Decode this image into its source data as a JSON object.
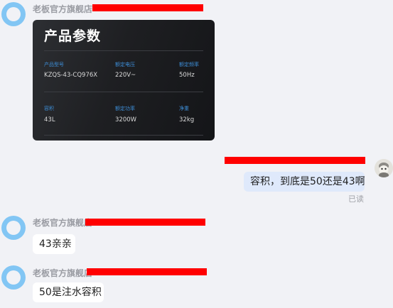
{
  "shop": {
    "name": "老板官方旗舰店"
  },
  "product_card": {
    "title": "产品参数",
    "specs": [
      {
        "label": "产品型号",
        "value": "KZQS-43-CQ976X"
      },
      {
        "label": "额定电压",
        "value": "220V~"
      },
      {
        "label": "额定频率",
        "value": "50Hz"
      },
      {
        "label": "容积",
        "value": "43L"
      },
      {
        "label": "额定功率",
        "value": "3200W"
      },
      {
        "label": "净重",
        "value": "32kg"
      }
    ]
  },
  "messages": {
    "user_question": "容积，到底是50还是43啊",
    "read_status": "已读",
    "reply_1": "43亲亲",
    "reply_2": "50是注水容积"
  },
  "colors": {
    "background": "#f1f2f6",
    "avatar": "#82c6f4",
    "redaction": "#ff0000",
    "self_bubble": "#dfe9fb",
    "spec_label": "#3d8ed8"
  }
}
